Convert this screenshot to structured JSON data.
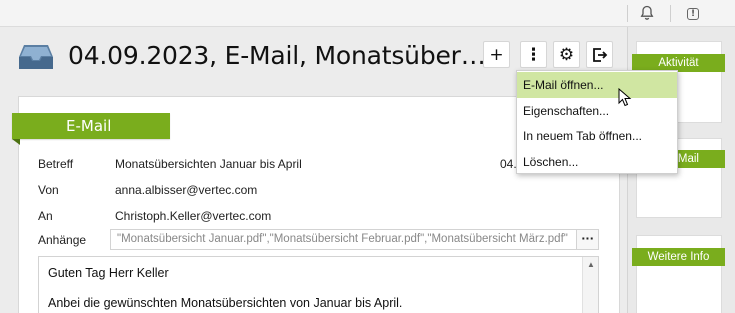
{
  "topbar": {
    "bell_icon": "bell-icon",
    "alert_icon": "alert-square-icon",
    "alert_glyph": "!"
  },
  "header": {
    "title": "04.09.2023, E-Mail, Monatsüber…",
    "tray_icon": "inbox-tray-icon",
    "buttons": {
      "add": "+",
      "more": "⋮",
      "settings": "⚙",
      "exit": "exit-icon"
    }
  },
  "menu": {
    "items": [
      {
        "label": "E-Mail öffnen..."
      },
      {
        "label": "Eigenschaften..."
      },
      {
        "label": "In neuem Tab öffnen..."
      },
      {
        "label": "Löschen..."
      }
    ],
    "highlight_color": "#d0e6a2"
  },
  "email": {
    "section_label": "E-Mail",
    "subject_label": "Betreff",
    "subject_value": "Monatsübersichten Januar bis April",
    "date_fragment": "04.",
    "from_label": "Von",
    "from_value": "anna.albisser@vertec.com",
    "to_label": "An",
    "to_value": "Christoph.Keller@vertec.com",
    "attachments_label": "Anhänge",
    "attachments_value": "\"Monatsübersicht Januar.pdf\",\"Monatsübersicht Februar.pdf\",\"Monatsübersicht März.pdf\"",
    "attachments_more": "···",
    "body_line1": "Guten Tag Herr Keller",
    "body_line2": "Anbei die gewünschten Monatsübersichten von Januar bis April."
  },
  "rail": {
    "activity_label": "Aktivität",
    "mail_label": "Mail",
    "further_info_label": "Weitere Info"
  },
  "colors": {
    "accent": "#7aad1d",
    "background": "#ececec"
  }
}
